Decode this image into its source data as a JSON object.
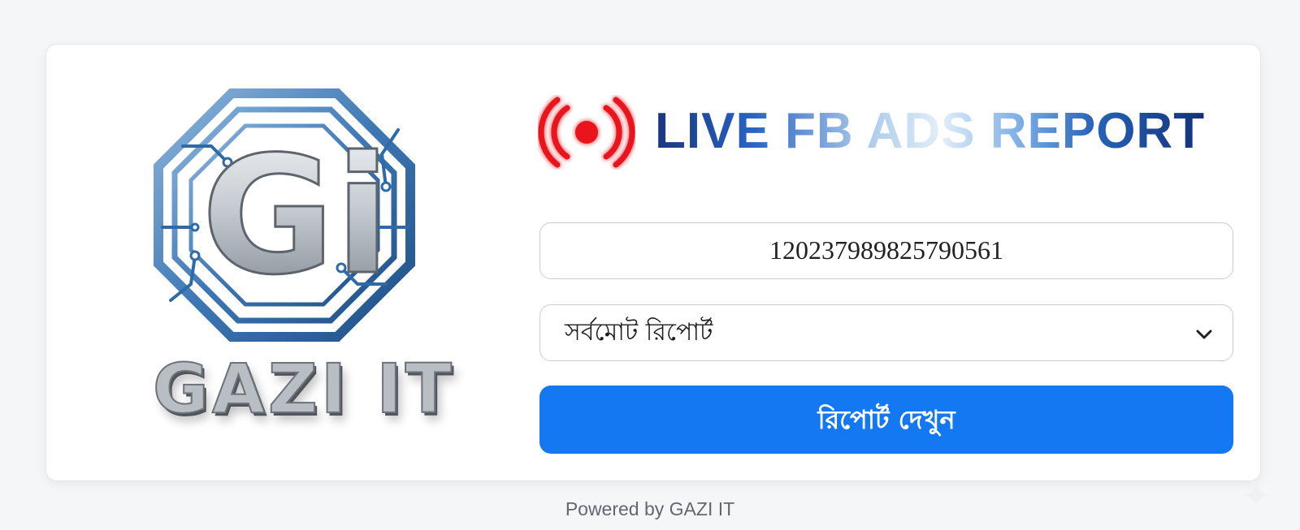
{
  "logo": {
    "monogram": "Gi",
    "brand_name": "GAZI IT"
  },
  "header": {
    "live_icon": "live-broadcast-icon",
    "title": "LIVE FB ADS REPORT"
  },
  "form": {
    "ad_account_id": "120237989825790561",
    "report_type": {
      "selected": "সর্বমোট রিপোর্ট",
      "icon": "chevron-down-icon"
    },
    "submit_label": "রিপোর্ট দেখুন"
  },
  "footer": {
    "text": "Powered by GAZI IT"
  },
  "colors": {
    "accent": "#1478f2",
    "live_red": "#e8121b",
    "title_dark": "#18367f"
  }
}
